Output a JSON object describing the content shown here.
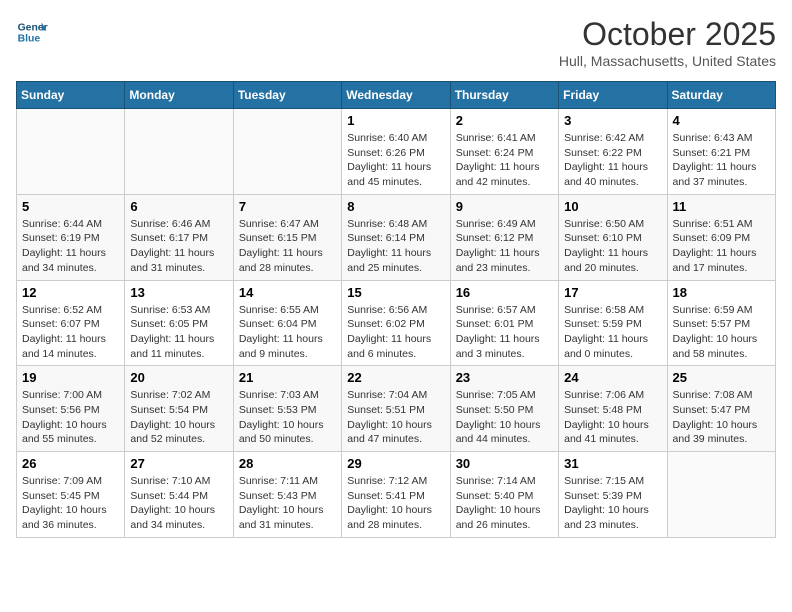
{
  "header": {
    "logo_line1": "General",
    "logo_line2": "Blue",
    "title": "October 2025",
    "subtitle": "Hull, Massachusetts, United States"
  },
  "days_of_week": [
    "Sunday",
    "Monday",
    "Tuesday",
    "Wednesday",
    "Thursday",
    "Friday",
    "Saturday"
  ],
  "weeks": [
    [
      {
        "day": "",
        "info": ""
      },
      {
        "day": "",
        "info": ""
      },
      {
        "day": "",
        "info": ""
      },
      {
        "day": "1",
        "info": "Sunrise: 6:40 AM\nSunset: 6:26 PM\nDaylight: 11 hours and 45 minutes."
      },
      {
        "day": "2",
        "info": "Sunrise: 6:41 AM\nSunset: 6:24 PM\nDaylight: 11 hours and 42 minutes."
      },
      {
        "day": "3",
        "info": "Sunrise: 6:42 AM\nSunset: 6:22 PM\nDaylight: 11 hours and 40 minutes."
      },
      {
        "day": "4",
        "info": "Sunrise: 6:43 AM\nSunset: 6:21 PM\nDaylight: 11 hours and 37 minutes."
      }
    ],
    [
      {
        "day": "5",
        "info": "Sunrise: 6:44 AM\nSunset: 6:19 PM\nDaylight: 11 hours and 34 minutes."
      },
      {
        "day": "6",
        "info": "Sunrise: 6:46 AM\nSunset: 6:17 PM\nDaylight: 11 hours and 31 minutes."
      },
      {
        "day": "7",
        "info": "Sunrise: 6:47 AM\nSunset: 6:15 PM\nDaylight: 11 hours and 28 minutes."
      },
      {
        "day": "8",
        "info": "Sunrise: 6:48 AM\nSunset: 6:14 PM\nDaylight: 11 hours and 25 minutes."
      },
      {
        "day": "9",
        "info": "Sunrise: 6:49 AM\nSunset: 6:12 PM\nDaylight: 11 hours and 23 minutes."
      },
      {
        "day": "10",
        "info": "Sunrise: 6:50 AM\nSunset: 6:10 PM\nDaylight: 11 hours and 20 minutes."
      },
      {
        "day": "11",
        "info": "Sunrise: 6:51 AM\nSunset: 6:09 PM\nDaylight: 11 hours and 17 minutes."
      }
    ],
    [
      {
        "day": "12",
        "info": "Sunrise: 6:52 AM\nSunset: 6:07 PM\nDaylight: 11 hours and 14 minutes."
      },
      {
        "day": "13",
        "info": "Sunrise: 6:53 AM\nSunset: 6:05 PM\nDaylight: 11 hours and 11 minutes."
      },
      {
        "day": "14",
        "info": "Sunrise: 6:55 AM\nSunset: 6:04 PM\nDaylight: 11 hours and 9 minutes."
      },
      {
        "day": "15",
        "info": "Sunrise: 6:56 AM\nSunset: 6:02 PM\nDaylight: 11 hours and 6 minutes."
      },
      {
        "day": "16",
        "info": "Sunrise: 6:57 AM\nSunset: 6:01 PM\nDaylight: 11 hours and 3 minutes."
      },
      {
        "day": "17",
        "info": "Sunrise: 6:58 AM\nSunset: 5:59 PM\nDaylight: 11 hours and 0 minutes."
      },
      {
        "day": "18",
        "info": "Sunrise: 6:59 AM\nSunset: 5:57 PM\nDaylight: 10 hours and 58 minutes."
      }
    ],
    [
      {
        "day": "19",
        "info": "Sunrise: 7:00 AM\nSunset: 5:56 PM\nDaylight: 10 hours and 55 minutes."
      },
      {
        "day": "20",
        "info": "Sunrise: 7:02 AM\nSunset: 5:54 PM\nDaylight: 10 hours and 52 minutes."
      },
      {
        "day": "21",
        "info": "Sunrise: 7:03 AM\nSunset: 5:53 PM\nDaylight: 10 hours and 50 minutes."
      },
      {
        "day": "22",
        "info": "Sunrise: 7:04 AM\nSunset: 5:51 PM\nDaylight: 10 hours and 47 minutes."
      },
      {
        "day": "23",
        "info": "Sunrise: 7:05 AM\nSunset: 5:50 PM\nDaylight: 10 hours and 44 minutes."
      },
      {
        "day": "24",
        "info": "Sunrise: 7:06 AM\nSunset: 5:48 PM\nDaylight: 10 hours and 41 minutes."
      },
      {
        "day": "25",
        "info": "Sunrise: 7:08 AM\nSunset: 5:47 PM\nDaylight: 10 hours and 39 minutes."
      }
    ],
    [
      {
        "day": "26",
        "info": "Sunrise: 7:09 AM\nSunset: 5:45 PM\nDaylight: 10 hours and 36 minutes."
      },
      {
        "day": "27",
        "info": "Sunrise: 7:10 AM\nSunset: 5:44 PM\nDaylight: 10 hours and 34 minutes."
      },
      {
        "day": "28",
        "info": "Sunrise: 7:11 AM\nSunset: 5:43 PM\nDaylight: 10 hours and 31 minutes."
      },
      {
        "day": "29",
        "info": "Sunrise: 7:12 AM\nSunset: 5:41 PM\nDaylight: 10 hours and 28 minutes."
      },
      {
        "day": "30",
        "info": "Sunrise: 7:14 AM\nSunset: 5:40 PM\nDaylight: 10 hours and 26 minutes."
      },
      {
        "day": "31",
        "info": "Sunrise: 7:15 AM\nSunset: 5:39 PM\nDaylight: 10 hours and 23 minutes."
      },
      {
        "day": "",
        "info": ""
      }
    ]
  ]
}
